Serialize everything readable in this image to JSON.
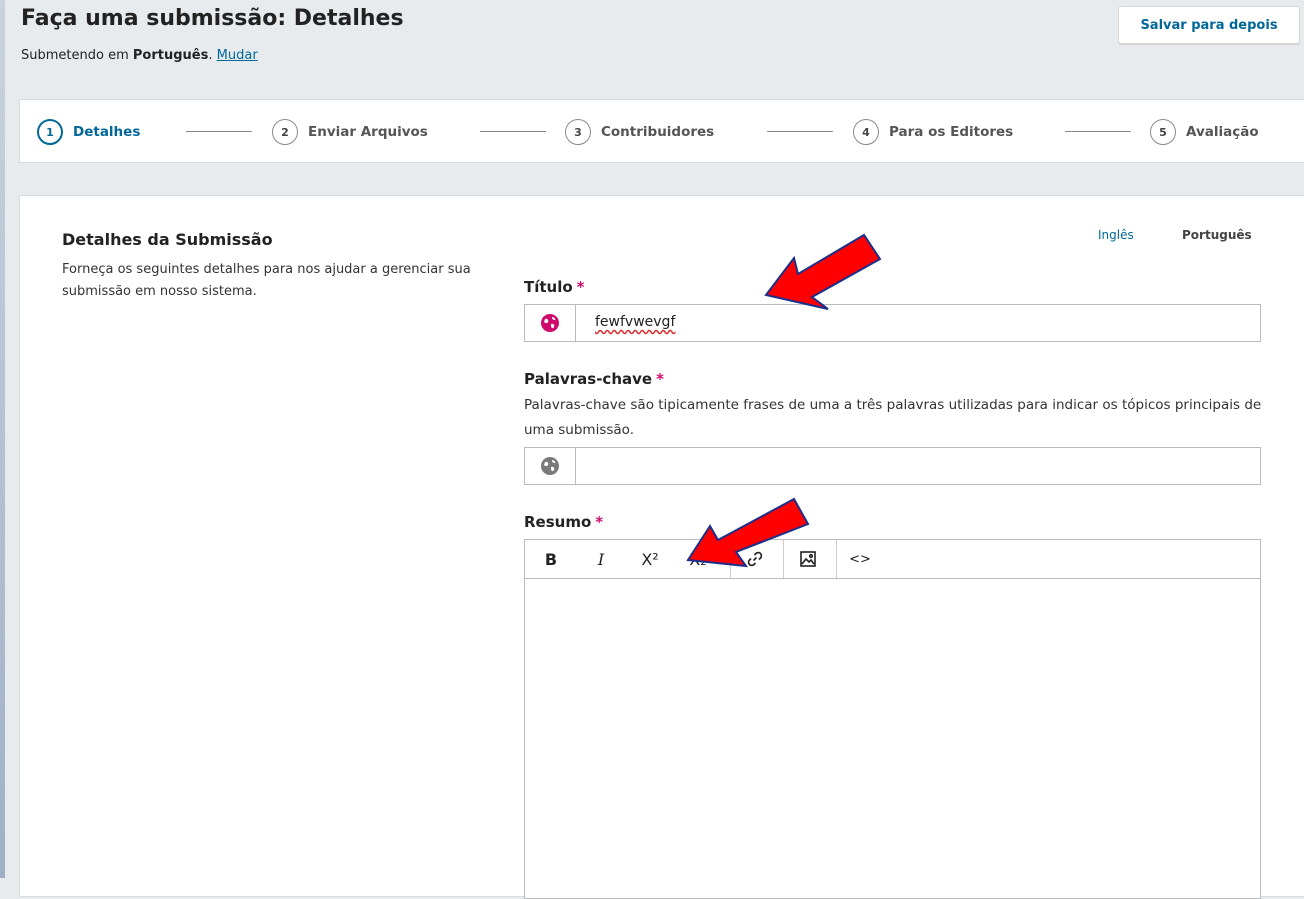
{
  "header": {
    "title": "Faça uma submissão: Detalhes",
    "subtitle_prefix": "Submetendo em",
    "language": "Português",
    "change_link": "Mudar",
    "save_later": "Salvar para depois"
  },
  "steps": [
    {
      "num": "1",
      "label": "Detalhes"
    },
    {
      "num": "2",
      "label": "Enviar Arquivos"
    },
    {
      "num": "3",
      "label": "Contribuidores"
    },
    {
      "num": "4",
      "label": "Para os Editores"
    },
    {
      "num": "5",
      "label": "Avaliação"
    }
  ],
  "section": {
    "title": "Detalhes da Submissão",
    "description": "Forneça os seguintes detalhes para nos ajudar a gerenciar sua submissão em nosso sistema."
  },
  "languages": {
    "english": "Inglês",
    "portuguese": "Português"
  },
  "fields": {
    "title_label": "Título",
    "title_value": "fewfvwevgf",
    "keywords_label": "Palavras-chave",
    "keywords_help": "Palavras-chave são tipicamente frases de uma a três palavras utilizadas para indicar os tópicos principais de uma submissão.",
    "keywords_value": "",
    "abstract_label": "Resumo",
    "required_marker": "*"
  },
  "toolbar": {
    "bold": "B",
    "italic": "I",
    "superscript": "X²",
    "subscript": "X₂",
    "code": "<>"
  },
  "colors": {
    "accent": "#006798",
    "required": "#d00a6c",
    "annotation_arrow": "#ff0000"
  }
}
